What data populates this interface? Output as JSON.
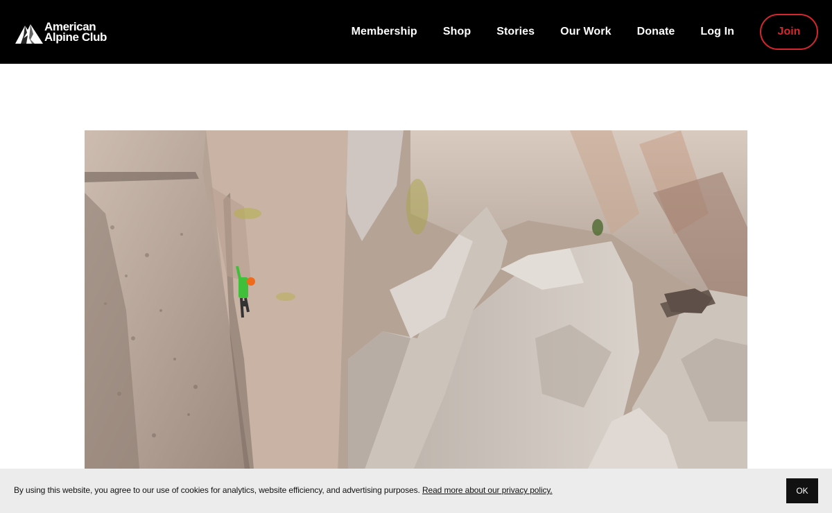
{
  "header": {
    "logo": {
      "line1": "American",
      "line2": "Alpine Club",
      "icon": "mountain-logo-icon"
    },
    "nav": [
      {
        "label": "Membership"
      },
      {
        "label": "Shop"
      },
      {
        "label": "Stories"
      },
      {
        "label": "Our Work"
      },
      {
        "label": "Donate"
      },
      {
        "label": "Log In"
      }
    ],
    "join_label": "Join",
    "colors": {
      "background": "#000000",
      "accent": "#d7262e",
      "text": "#ffffff"
    }
  },
  "hero": {
    "image_subject": "climber-on-granite-rock-formations"
  },
  "cookie_banner": {
    "text": "By using this website, you agree to our use of cookies for analytics, website efficiency, and advertising purposes.",
    "link_text": "Read more about our privacy policy.",
    "ok_label": "OK"
  }
}
